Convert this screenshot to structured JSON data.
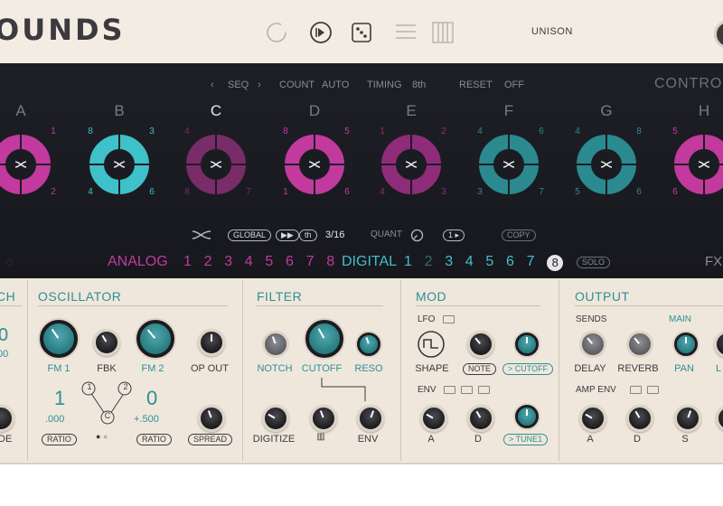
{
  "header": {
    "logo": "OUNDS",
    "unison_label": "UNISON",
    "icons": [
      "refresh-icon",
      "play-step-icon",
      "dice-icon",
      "menu-lines-icon",
      "piano-keys-icon"
    ]
  },
  "sequencer": {
    "seq_label": "SEQ",
    "count_label": "COUNT",
    "count_value": "AUTO",
    "timing_label": "TIMING",
    "timing_value": "8th",
    "reset_label": "RESET",
    "reset_value": "OFF",
    "control_label": "CONTROL",
    "slots": [
      {
        "letter": "A",
        "tl": "",
        "tr": "1",
        "bl": "",
        "br": "2",
        "color": "#c23a9e"
      },
      {
        "letter": "B",
        "tl": "8",
        "tr": "3",
        "bl": "4",
        "br": "6",
        "color": "#3fc1c9"
      },
      {
        "letter": "C",
        "tl": "4",
        "tr": "",
        "bl": "8",
        "br": "7",
        "color": "#7a2c68"
      },
      {
        "letter": "D",
        "tl": "8",
        "tr": "5",
        "bl": "1",
        "br": "6",
        "color": "#c23a9e"
      },
      {
        "letter": "E",
        "tl": "1",
        "tr": "2",
        "bl": "4",
        "br": "3",
        "color": "#8f2c7a"
      },
      {
        "letter": "F",
        "tl": "4",
        "tr": "6",
        "bl": "3",
        "br": "7",
        "color": "#2a8a90"
      },
      {
        "letter": "G",
        "tl": "4",
        "tr": "8",
        "bl": "5",
        "br": "6",
        "color": "#2a8a90"
      },
      {
        "letter": "H",
        "tl": "5",
        "tr": "",
        "bl": "6",
        "br": "",
        "color": "#c23a9e"
      }
    ],
    "global_label": "GLOBAL",
    "th_label": "th",
    "step_value": "3/16",
    "quant_label": "QUANT",
    "copy_label": "COPY",
    "bank_analog": "ANALOG",
    "bank_digital": "DIGITAL",
    "analog_numbers": [
      "1",
      "2",
      "3",
      "4",
      "5",
      "6",
      "7",
      "8"
    ],
    "digital_numbers": [
      "1",
      "2",
      "3",
      "4",
      "5",
      "6",
      "7",
      "8"
    ],
    "solo_label": "SOLO",
    "fx_label": "FX"
  },
  "oscillator": {
    "title": "OSCILLATOR",
    "fm1_label": "FM 1",
    "fbk_label": "FBK",
    "fm2_label": "FM 2",
    "opout_label": "OP OUT",
    "ratio1_big": "1",
    "ratio1_small": ".000",
    "ratio2_big": "0",
    "ratio2_small": "+.500",
    "node1": "1",
    "node2": "2",
    "nodec": "C",
    "ratio_label": "RATIO",
    "spread_label": "SPREAD"
  },
  "left_partial": {
    "title": "CH",
    "label_bottom": "DE"
  },
  "filter": {
    "title": "FILTER",
    "notch_label": "NOTCH",
    "cutoff_label": "CUTOFF",
    "reso_label": "RESO",
    "digitize_label": "DIGITIZE",
    "env_label": "ENV"
  },
  "mod": {
    "title": "MOD",
    "lfo_label": "LFO",
    "shape_label": "SHAPE",
    "note_label": "NOTE",
    "cutoff_tag": "> CUTOFF",
    "env_label": "ENV",
    "a_label": "A",
    "d_label": "D",
    "tune_tag": "> TUNE1"
  },
  "output": {
    "title": "OUTPUT",
    "sends_label": "SENDS",
    "main_label": "MAIN",
    "delay_label": "DELAY",
    "reverb_label": "REVERB",
    "pan_label": "PAN",
    "amp_env_label": "AMP ENV",
    "a_label": "A",
    "d_label": "D",
    "s_label": "S",
    "partial_label": "L"
  }
}
